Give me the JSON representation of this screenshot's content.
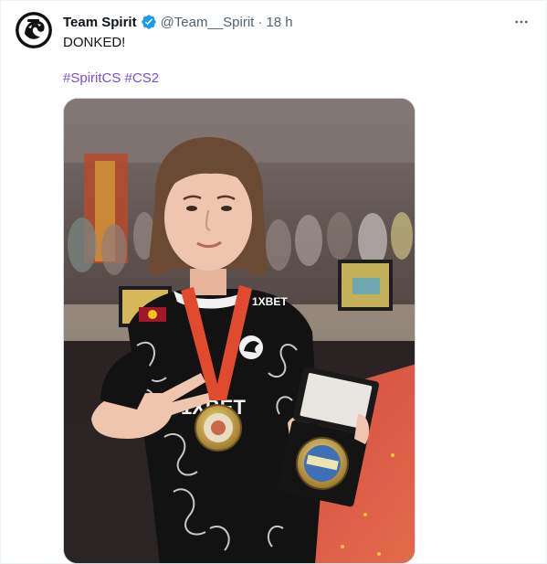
{
  "tweet": {
    "author_name": "Team Spirit",
    "author_handle": "@Team__Spirit",
    "separator": "·",
    "timestamp": "18 h",
    "text": "DONKED!",
    "hashtags": [
      "#SpiritCS",
      "#CS2"
    ],
    "verified": true,
    "avatar_icon": "team-spirit-logo-icon",
    "more_icon": "more-options-icon"
  },
  "colors": {
    "verified": "#1d9bf0",
    "hashtag": "#7c4dd8",
    "secondary_text": "#536471",
    "primary_text": "#0f1419",
    "border": "#cfd9de"
  },
  "media": {
    "jersey_sponsor": "1XBET",
    "jersey_chest_logo": "1XBET"
  }
}
